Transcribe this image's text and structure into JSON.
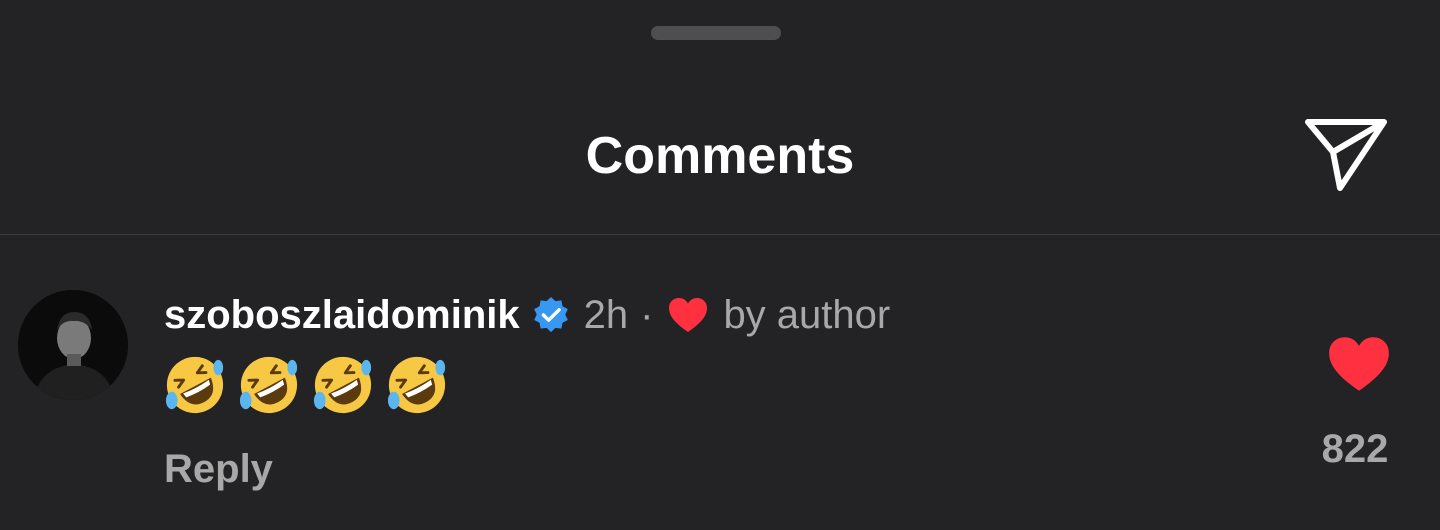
{
  "sheet": {
    "title": "Comments",
    "share_icon": "paper-plane-icon"
  },
  "comment": {
    "avatar_icon": "user-avatar",
    "username": "szoboszlaidominik",
    "verified_icon": "verified-badge-icon",
    "verified_color": "#3897f0",
    "time": "2h",
    "separator": "·",
    "author_like_icon": "heart-icon",
    "author_like_color": "#ff3040",
    "author_like_text": "by author",
    "text": "🤣🤣🤣🤣",
    "reply_label": "Reply",
    "like_icon": "heart-icon",
    "like_color": "#ff3040",
    "like_count": "822"
  }
}
